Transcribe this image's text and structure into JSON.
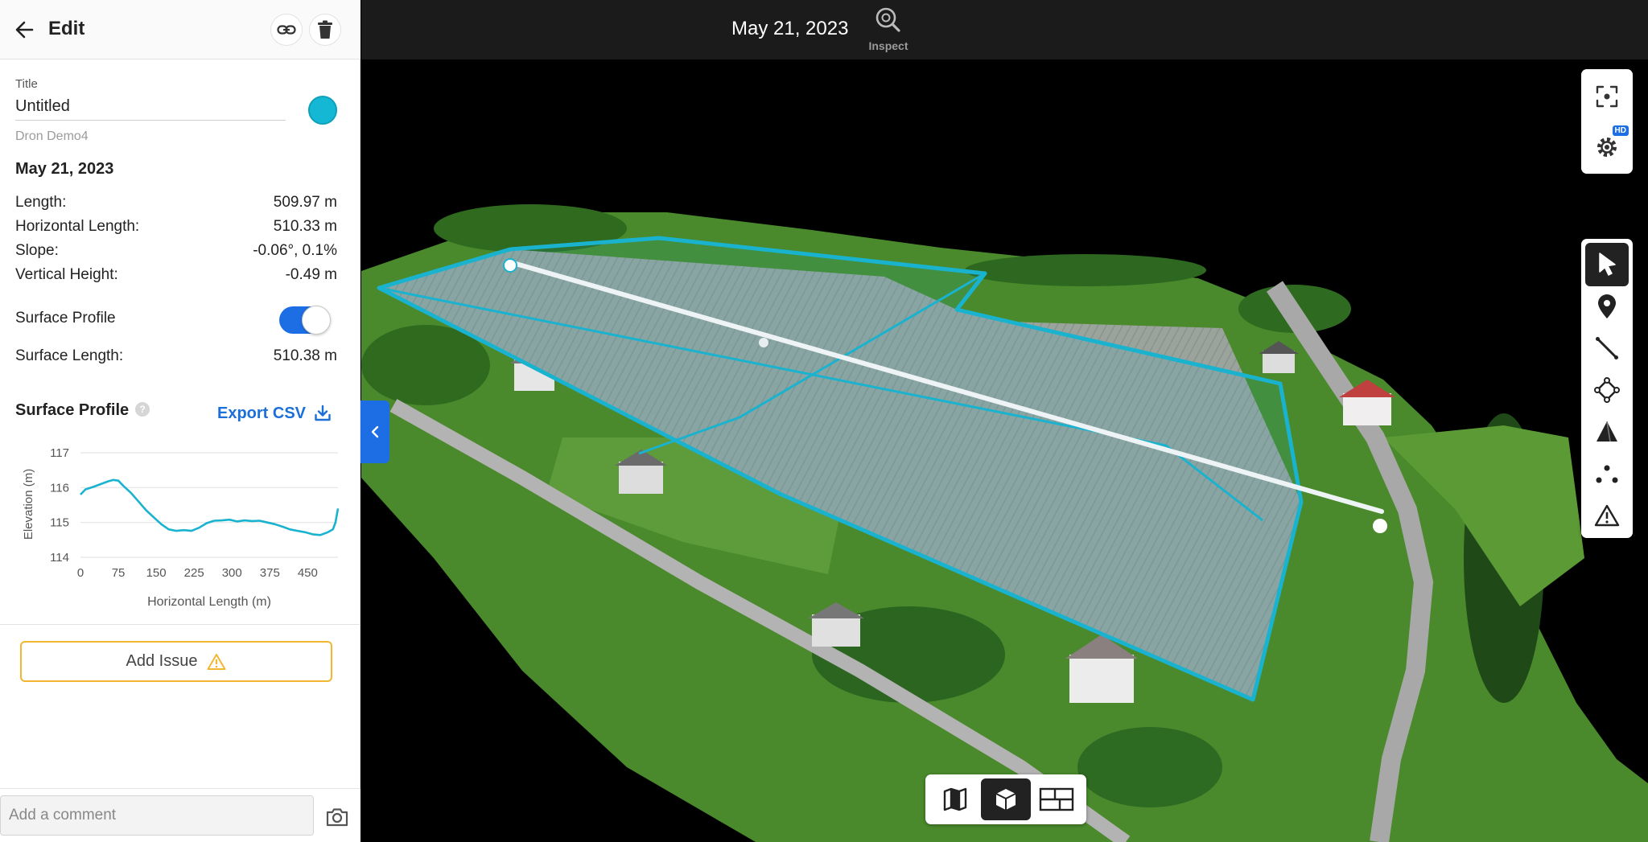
{
  "sidebar": {
    "header_title": "Edit",
    "title_label": "Title",
    "title_value": "Untitled",
    "project_name": "Dron Demo4",
    "date": "May 21, 2023",
    "stats": {
      "length": {
        "label": "Length:",
        "value": "509.97 m"
      },
      "horizontal_length": {
        "label": "Horizontal Length:",
        "value": "510.33 m"
      },
      "slope": {
        "label": "Slope:",
        "value": "-0.06°, 0.1%"
      },
      "vertical_height": {
        "label": "Vertical Height:",
        "value": "-0.49 m"
      }
    },
    "surface_profile_label": "Surface Profile",
    "surface_profile_enabled": true,
    "surface_length": {
      "label": "Surface Length:",
      "value": "510.38 m"
    },
    "profile_heading": "Surface Profile",
    "help_glyph": "?",
    "export_label": "Export CSV",
    "add_issue_label": "Add Issue",
    "comment_placeholder": "Add a comment",
    "accent_color": "#14b8d4",
    "toggle_color": "#1d6ee5",
    "issue_border_color": "#f2b632"
  },
  "topbar": {
    "date": "May 21, 2023",
    "inspect_label": "Inspect"
  },
  "view_tools": [
    {
      "name": "focus-icon"
    },
    {
      "name": "settings-icon",
      "badge": "HD"
    }
  ],
  "draw_tools": [
    {
      "name": "pointer-icon",
      "active": true
    },
    {
      "name": "location-pin-icon"
    },
    {
      "name": "line-measure-icon"
    },
    {
      "name": "polygon-icon"
    },
    {
      "name": "volume-icon"
    },
    {
      "name": "points-icon"
    },
    {
      "name": "warning-icon"
    }
  ],
  "view_switch": [
    {
      "name": "map-2d-icon"
    },
    {
      "name": "model-3d-icon",
      "active": true
    },
    {
      "name": "split-view-icon"
    }
  ],
  "chart_data": {
    "type": "line",
    "xlabel": "Horizontal Length (m)",
    "ylabel": "Elevation (m)",
    "xlim": [
      0,
      510
    ],
    "ylim": [
      114,
      117
    ],
    "xticks": [
      "0",
      "75",
      "150",
      "225",
      "300",
      "375",
      "450"
    ],
    "yticks": [
      "114",
      "115",
      "116",
      "117"
    ],
    "grid": true,
    "color": "#1ab3cf",
    "x": [
      0,
      10,
      25,
      40,
      55,
      65,
      75,
      85,
      100,
      115,
      130,
      145,
      160,
      175,
      190,
      205,
      220,
      235,
      250,
      265,
      280,
      295,
      310,
      325,
      340,
      355,
      370,
      385,
      400,
      415,
      430,
      445,
      460,
      475,
      490,
      500,
      505,
      510
    ],
    "y": [
      115.8,
      115.95,
      116.02,
      116.1,
      116.18,
      116.22,
      116.2,
      116.05,
      115.85,
      115.6,
      115.35,
      115.15,
      114.95,
      114.8,
      114.76,
      114.78,
      114.76,
      114.85,
      114.98,
      115.05,
      115.06,
      115.08,
      115.03,
      115.06,
      115.04,
      115.05,
      115.0,
      114.95,
      114.88,
      114.8,
      114.76,
      114.72,
      114.66,
      114.64,
      114.72,
      114.8,
      115.0,
      115.4
    ]
  }
}
